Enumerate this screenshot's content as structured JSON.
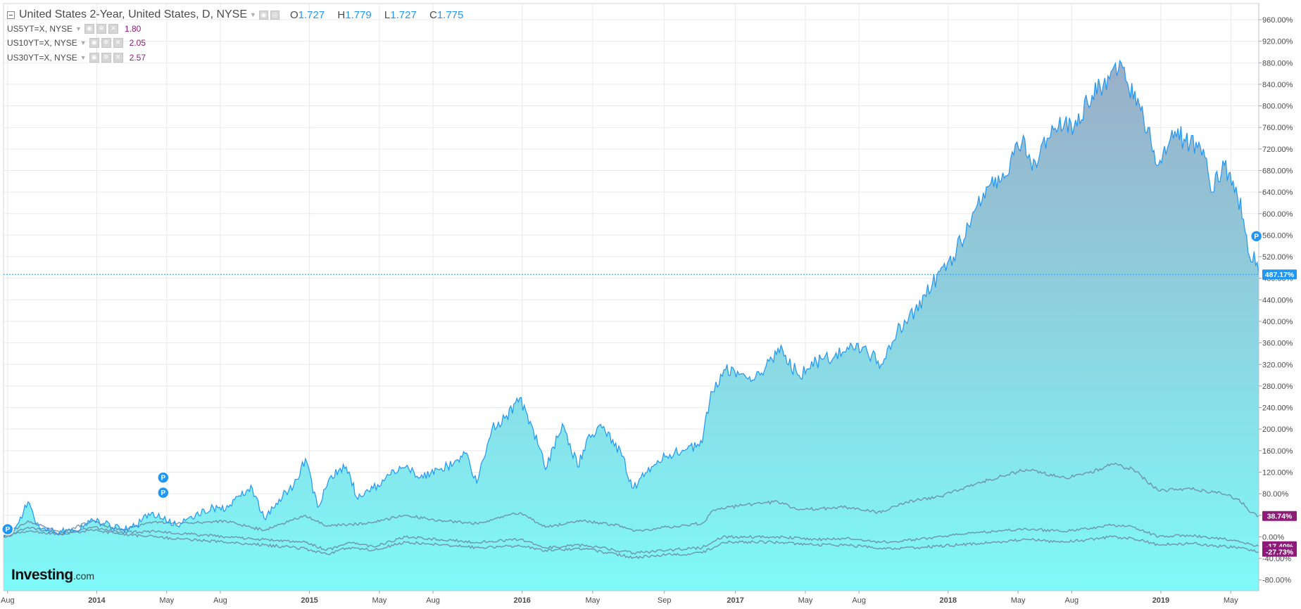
{
  "header": {
    "title": "United States 2-Year, United States, D, NYSE",
    "ohlc": [
      {
        "key": "O",
        "value": "1.727"
      },
      {
        "key": "H",
        "value": "1.779"
      },
      {
        "key": "L",
        "value": "1.727"
      },
      {
        "key": "C",
        "value": "1.775"
      }
    ]
  },
  "legend": [
    {
      "name": "US5YT=X, NYSE",
      "value": "1.80"
    },
    {
      "name": "US10YT=X, NYSE",
      "value": "2.05"
    },
    {
      "name": "US30YT=X, NYSE",
      "value": "2.57"
    }
  ],
  "logo": {
    "text": "Investing",
    "suffix": ".com"
  },
  "colors": {
    "main_line": "#2196f3",
    "fill_top": "#9aaec7",
    "fill_bottom": "#7ff9f9",
    "comparison_line": "#6b8aa5",
    "purple": "#8e1a7a",
    "axis_text": "#4a4a4a",
    "grid": "#e9e9e9"
  },
  "icons": [
    "collapse-icon",
    "dropdown-caret-icon",
    "settings-icon",
    "close-icon",
    "event-marker-icon"
  ],
  "chart_data": {
    "type": "area",
    "y_unit": "percent change",
    "ylim": [
      -100,
      990
    ],
    "y_ticks": [
      "960.00%",
      "920.00%",
      "880.00%",
      "840.00%",
      "800.00%",
      "760.00%",
      "720.00%",
      "680.00%",
      "640.00%",
      "600.00%",
      "560.00%",
      "520.00%",
      "480.00%",
      "440.00%",
      "400.00%",
      "360.00%",
      "320.00%",
      "280.00%",
      "240.00%",
      "200.00%",
      "160.00%",
      "120.00%",
      "80.00%",
      "40.00%",
      "0.00%",
      "-40.00%",
      "-80.00%"
    ],
    "x_range": [
      "2013-07-25",
      "2019-06-18"
    ],
    "x_ticks": [
      {
        "label": "Aug",
        "date": "2013-08-01",
        "bold": false
      },
      {
        "label": "2014",
        "date": "2014-01-01",
        "bold": true
      },
      {
        "label": "May",
        "date": "2014-05-01",
        "bold": false
      },
      {
        "label": "Aug",
        "date": "2014-08-01",
        "bold": false
      },
      {
        "label": "2015",
        "date": "2015-01-01",
        "bold": true
      },
      {
        "label": "May",
        "date": "2015-05-01",
        "bold": false
      },
      {
        "label": "Aug",
        "date": "2015-08-01",
        "bold": false
      },
      {
        "label": "2016",
        "date": "2016-01-01",
        "bold": true
      },
      {
        "label": "May",
        "date": "2016-05-01",
        "bold": false
      },
      {
        "label": "Sep",
        "date": "2016-09-01",
        "bold": false
      },
      {
        "label": "2017",
        "date": "2017-01-01",
        "bold": true
      },
      {
        "label": "May",
        "date": "2017-05-01",
        "bold": false
      },
      {
        "label": "Aug",
        "date": "2017-08-01",
        "bold": false
      },
      {
        "label": "2018",
        "date": "2018-01-01",
        "bold": true
      },
      {
        "label": "May",
        "date": "2018-05-01",
        "bold": false
      },
      {
        "label": "Aug",
        "date": "2018-08-01",
        "bold": false
      },
      {
        "label": "2019",
        "date": "2019-01-01",
        "bold": true
      },
      {
        "label": "May",
        "date": "2019-05-01",
        "bold": false
      }
    ],
    "grid": true,
    "series": [
      {
        "name": "United States 2-Year",
        "role": "main-area",
        "last_label": "487.17%",
        "points": [
          [
            "2013-07-25",
            0
          ],
          [
            "2013-08-15",
            18
          ],
          [
            "2013-09-05",
            65
          ],
          [
            "2013-09-20",
            22
          ],
          [
            "2013-10-20",
            8
          ],
          [
            "2013-11-25",
            12
          ],
          [
            "2013-12-20",
            28
          ],
          [
            "2014-01-15",
            25
          ],
          [
            "2014-02-10",
            15
          ],
          [
            "2014-03-10",
            22
          ],
          [
            "2014-04-05",
            45
          ],
          [
            "2014-04-25",
            32
          ],
          [
            "2014-05-20",
            20
          ],
          [
            "2014-06-20",
            42
          ],
          [
            "2014-07-20",
            55
          ],
          [
            "2014-08-10",
            50
          ],
          [
            "2014-09-05",
            75
          ],
          [
            "2014-09-25",
            90
          ],
          [
            "2014-10-15",
            35
          ],
          [
            "2014-11-10",
            70
          ],
          [
            "2014-12-05",
            95
          ],
          [
            "2014-12-25",
            145
          ],
          [
            "2015-01-15",
            55
          ],
          [
            "2015-02-05",
            110
          ],
          [
            "2015-03-05",
            130
          ],
          [
            "2015-03-25",
            70
          ],
          [
            "2015-04-20",
            90
          ],
          [
            "2015-05-20",
            115
          ],
          [
            "2015-06-15",
            130
          ],
          [
            "2015-07-10",
            110
          ],
          [
            "2015-08-10",
            125
          ],
          [
            "2015-09-05",
            135
          ],
          [
            "2015-09-25",
            155
          ],
          [
            "2015-10-15",
            100
          ],
          [
            "2015-11-10",
            200
          ],
          [
            "2015-12-05",
            225
          ],
          [
            "2015-12-28",
            258
          ],
          [
            "2016-01-20",
            200
          ],
          [
            "2016-02-10",
            125
          ],
          [
            "2016-03-10",
            210
          ],
          [
            "2016-04-05",
            130
          ],
          [
            "2016-04-25",
            190
          ],
          [
            "2016-05-20",
            205
          ],
          [
            "2016-06-20",
            150
          ],
          [
            "2016-07-10",
            90
          ],
          [
            "2016-08-10",
            130
          ],
          [
            "2016-09-05",
            150
          ],
          [
            "2016-10-05",
            160
          ],
          [
            "2016-11-05",
            175
          ],
          [
            "2016-11-20",
            270
          ],
          [
            "2016-12-15",
            310
          ],
          [
            "2017-01-20",
            295
          ],
          [
            "2017-02-20",
            310
          ],
          [
            "2017-03-15",
            350
          ],
          [
            "2017-04-20",
            300
          ],
          [
            "2017-05-20",
            325
          ],
          [
            "2017-06-20",
            335
          ],
          [
            "2017-07-20",
            355
          ],
          [
            "2017-08-15",
            345
          ],
          [
            "2017-09-08",
            320
          ],
          [
            "2017-10-05",
            380
          ],
          [
            "2017-11-05",
            420
          ],
          [
            "2017-12-05",
            470
          ],
          [
            "2018-01-10",
            520
          ],
          [
            "2018-02-10",
            590
          ],
          [
            "2018-03-10",
            650
          ],
          [
            "2018-04-10",
            670
          ],
          [
            "2018-05-10",
            745
          ],
          [
            "2018-05-25",
            680
          ],
          [
            "2018-06-20",
            740
          ],
          [
            "2018-07-20",
            770
          ],
          [
            "2018-08-05",
            760
          ],
          [
            "2018-09-05",
            820
          ],
          [
            "2018-10-05",
            850
          ],
          [
            "2018-10-25",
            880
          ],
          [
            "2018-11-20",
            800
          ],
          [
            "2018-12-10",
            760
          ],
          [
            "2018-12-28",
            690
          ],
          [
            "2019-01-20",
            755
          ],
          [
            "2019-02-20",
            730
          ],
          [
            "2019-03-15",
            720
          ],
          [
            "2019-03-28",
            640
          ],
          [
            "2019-04-20",
            690
          ],
          [
            "2019-05-10",
            650
          ],
          [
            "2019-05-28",
            560
          ],
          [
            "2019-06-05",
            510
          ],
          [
            "2019-06-10",
            530
          ],
          [
            "2019-06-18",
            487.17
          ]
        ]
      },
      {
        "name": "US5YT=X, NYSE",
        "role": "comparison",
        "last_label": "38.74%",
        "points": [
          [
            "2013-07-25",
            0
          ],
          [
            "2013-09-05",
            30
          ],
          [
            "2013-11-01",
            8
          ],
          [
            "2013-12-25",
            30
          ],
          [
            "2014-02-10",
            12
          ],
          [
            "2014-04-10",
            28
          ],
          [
            "2014-06-10",
            25
          ],
          [
            "2014-08-10",
            30
          ],
          [
            "2014-10-15",
            12
          ],
          [
            "2014-12-25",
            40
          ],
          [
            "2015-02-01",
            20
          ],
          [
            "2015-04-10",
            25
          ],
          [
            "2015-06-15",
            40
          ],
          [
            "2015-08-15",
            30
          ],
          [
            "2015-10-15",
            25
          ],
          [
            "2015-12-28",
            45
          ],
          [
            "2016-02-10",
            18
          ],
          [
            "2016-04-15",
            30
          ],
          [
            "2016-06-20",
            20
          ],
          [
            "2016-07-10",
            10
          ],
          [
            "2016-09-05",
            18
          ],
          [
            "2016-11-05",
            25
          ],
          [
            "2016-11-25",
            50
          ],
          [
            "2017-01-20",
            60
          ],
          [
            "2017-03-15",
            65
          ],
          [
            "2017-04-20",
            50
          ],
          [
            "2017-07-10",
            55
          ],
          [
            "2017-09-08",
            45
          ],
          [
            "2017-10-20",
            65
          ],
          [
            "2017-12-20",
            75
          ],
          [
            "2018-02-20",
            100
          ],
          [
            "2018-05-15",
            125
          ],
          [
            "2018-07-20",
            110
          ],
          [
            "2018-08-20",
            115
          ],
          [
            "2018-10-10",
            135
          ],
          [
            "2018-11-15",
            125
          ],
          [
            "2018-12-28",
            85
          ],
          [
            "2019-02-20",
            90
          ],
          [
            "2019-04-15",
            80
          ],
          [
            "2019-05-15",
            70
          ],
          [
            "2019-06-05",
            45
          ],
          [
            "2019-06-18",
            38.74
          ]
        ]
      },
      {
        "name": "US10YT=X, NYSE",
        "role": "comparison",
        "last_label": "-17.40%",
        "points": [
          [
            "2013-07-25",
            0
          ],
          [
            "2013-09-05",
            18
          ],
          [
            "2013-11-01",
            5
          ],
          [
            "2013-12-25",
            18
          ],
          [
            "2014-02-10",
            8
          ],
          [
            "2014-04-10",
            10
          ],
          [
            "2014-06-10",
            5
          ],
          [
            "2014-08-10",
            0
          ],
          [
            "2014-10-15",
            -5
          ],
          [
            "2014-12-25",
            -10
          ],
          [
            "2015-01-30",
            -25
          ],
          [
            "2015-03-10",
            -10
          ],
          [
            "2015-04-20",
            -18
          ],
          [
            "2015-06-15",
            0
          ],
          [
            "2015-08-15",
            -5
          ],
          [
            "2015-10-15",
            -10
          ],
          [
            "2015-12-28",
            -5
          ],
          [
            "2016-02-10",
            -20
          ],
          [
            "2016-04-15",
            -15
          ],
          [
            "2016-07-10",
            -30
          ],
          [
            "2016-09-05",
            -25
          ],
          [
            "2016-11-05",
            -20
          ],
          [
            "2016-12-10",
            0
          ],
          [
            "2017-03-15",
            0
          ],
          [
            "2017-05-20",
            -5
          ],
          [
            "2017-07-10",
            -3
          ],
          [
            "2017-09-08",
            -10
          ],
          [
            "2017-11-10",
            -5
          ],
          [
            "2018-01-20",
            5
          ],
          [
            "2018-05-15",
            15
          ],
          [
            "2018-07-20",
            10
          ],
          [
            "2018-10-10",
            22
          ],
          [
            "2018-11-15",
            18
          ],
          [
            "2018-12-28",
            0
          ],
          [
            "2019-02-20",
            3
          ],
          [
            "2019-04-15",
            -3
          ],
          [
            "2019-05-20",
            -10
          ],
          [
            "2019-06-18",
            -17.4
          ]
        ]
      },
      {
        "name": "US30YT=X, NYSE",
        "role": "comparison",
        "last_label": "-27.73%",
        "points": [
          [
            "2013-07-25",
            0
          ],
          [
            "2013-09-05",
            10
          ],
          [
            "2013-11-01",
            5
          ],
          [
            "2013-12-25",
            12
          ],
          [
            "2014-02-10",
            5
          ],
          [
            "2014-04-10",
            0
          ],
          [
            "2014-06-10",
            -5
          ],
          [
            "2014-08-10",
            -10
          ],
          [
            "2014-10-15",
            -15
          ],
          [
            "2014-12-25",
            -22
          ],
          [
            "2015-01-30",
            -32
          ],
          [
            "2015-03-10",
            -20
          ],
          [
            "2015-04-20",
            -25
          ],
          [
            "2015-06-15",
            -10
          ],
          [
            "2015-08-15",
            -15
          ],
          [
            "2015-10-15",
            -20
          ],
          [
            "2015-12-28",
            -17
          ],
          [
            "2016-02-10",
            -25
          ],
          [
            "2016-04-15",
            -22
          ],
          [
            "2016-07-10",
            -38
          ],
          [
            "2016-09-05",
            -33
          ],
          [
            "2016-11-05",
            -30
          ],
          [
            "2016-12-10",
            -10
          ],
          [
            "2017-03-15",
            -10
          ],
          [
            "2017-05-20",
            -15
          ],
          [
            "2017-07-10",
            -15
          ],
          [
            "2017-09-08",
            -22
          ],
          [
            "2017-11-10",
            -20
          ],
          [
            "2018-01-20",
            -15
          ],
          [
            "2018-05-15",
            -5
          ],
          [
            "2018-07-20",
            -10
          ],
          [
            "2018-10-10",
            0
          ],
          [
            "2018-11-15",
            -3
          ],
          [
            "2018-12-28",
            -15
          ],
          [
            "2019-02-20",
            -12
          ],
          [
            "2019-04-15",
            -18
          ],
          [
            "2019-05-20",
            -20
          ],
          [
            "2019-06-18",
            -27.73
          ]
        ]
      }
    ],
    "markers": [
      {
        "label": "P",
        "date": "2013-08-01",
        "value": 14
      },
      {
        "label": "P",
        "date": "2014-04-25",
        "value": 82
      },
      {
        "label": "P",
        "date": "2014-04-25",
        "value": 110
      },
      {
        "label": "P",
        "date": "2019-06-14",
        "value": 558
      }
    ]
  }
}
